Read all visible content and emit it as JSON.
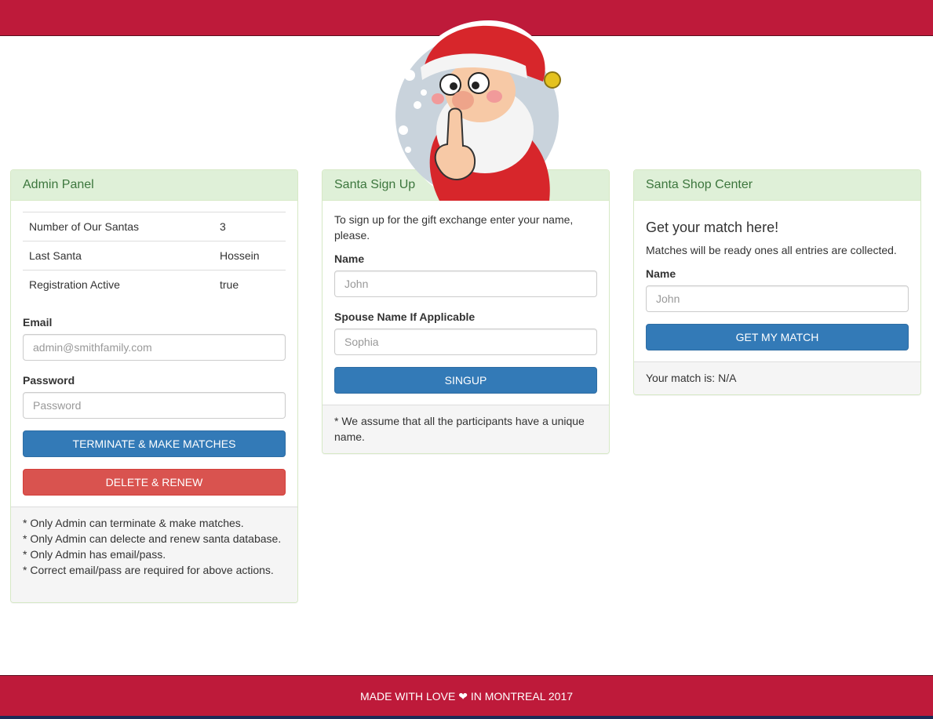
{
  "header": {
    "brand_color": "#be1a3a"
  },
  "mascot": {
    "icon": "santa-shush-icon"
  },
  "admin": {
    "title": "Admin Panel",
    "stats": [
      {
        "label": "Number of Our Santas",
        "value": "3"
      },
      {
        "label": "Last Santa",
        "value": "Hossein"
      },
      {
        "label": "Registration Active",
        "value": "true"
      }
    ],
    "email_label": "Email",
    "email_placeholder": "admin@smithfamily.com",
    "password_label": "Password",
    "password_placeholder": "Password",
    "terminate_label": "TERMINATE & MAKE MATCHES",
    "delete_label": "DELETE & RENEW",
    "notes": [
      "* Only Admin can terminate & make matches.",
      "* Only Admin can delecte and renew santa database.",
      "* Only Admin has email/pass.",
      "* Correct email/pass are required for above actions."
    ]
  },
  "signup": {
    "title": "Santa Sign Up",
    "intro": "To sign up for the gift exchange enter your name, please.",
    "name_label": "Name",
    "name_placeholder": "John",
    "spouse_label": "Spouse Name If Applicable",
    "spouse_placeholder": "Sophia",
    "button_label": "SINGUP",
    "note": "* We assume that all the participants have a unique name."
  },
  "shop": {
    "title": "Santa Shop Center",
    "heading": "Get your match here!",
    "subtext": "Matches will be ready ones all entries are collected.",
    "name_label": "Name",
    "name_placeholder": "John",
    "button_label": "GET MY MATCH",
    "result": "Your match is: N/A"
  },
  "footer": {
    "text_before": "MADE WITH LOVE",
    "heart_icon": "heart-icon",
    "text_after": "IN MONTREAL 2017"
  }
}
